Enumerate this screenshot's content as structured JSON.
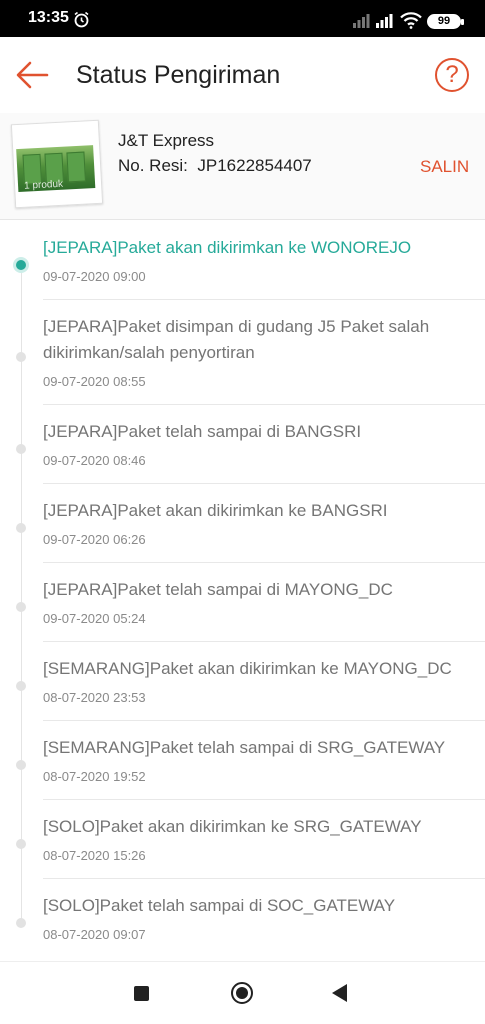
{
  "status_bar": {
    "time": "13:35",
    "battery": "99",
    "icons": [
      "alarm-icon",
      "signal-icon",
      "signal-icon",
      "wifi-icon",
      "battery-icon"
    ]
  },
  "header": {
    "title": "Status Pengiriman",
    "back_icon": "arrow-left-icon",
    "help_label": "?"
  },
  "shipment": {
    "courier": "J&T Express",
    "resi_label": "No. Resi:",
    "resi_number": "JP1622854407",
    "copy_label": "SALIN",
    "product_count": "1 produk"
  },
  "timeline": [
    {
      "text": "[JEPARA]Paket akan dikirimkan ke WONOREJO",
      "time": "09-07-2020 09:00",
      "active": true
    },
    {
      "text": "[JEPARA]Paket disimpan di gudang J5 Paket salah dikirimkan/salah penyortiran",
      "time": "09-07-2020 08:55",
      "active": false
    },
    {
      "text": "[JEPARA]Paket telah sampai di BANGSRI",
      "time": "09-07-2020 08:46",
      "active": false
    },
    {
      "text": "[JEPARA]Paket akan dikirimkan ke BANGSRI",
      "time": "09-07-2020 06:26",
      "active": false
    },
    {
      "text": "[JEPARA]Paket telah sampai di MAYONG_DC",
      "time": "09-07-2020 05:24",
      "active": false
    },
    {
      "text": "[SEMARANG]Paket akan dikirimkan ke MAYONG_DC",
      "time": "08-07-2020 23:53",
      "active": false
    },
    {
      "text": "[SEMARANG]Paket telah sampai di SRG_GATEWAY",
      "time": "08-07-2020 19:52",
      "active": false
    },
    {
      "text": "[SOLO]Paket akan dikirimkan ke SRG_GATEWAY",
      "time": "08-07-2020 15:26",
      "active": false
    },
    {
      "text": "[SOLO]Paket telah sampai di SOC_GATEWAY",
      "time": "08-07-2020 09:07",
      "active": false
    }
  ],
  "colors": {
    "accent": "#e0522f",
    "active": "#26aa99",
    "text_muted": "#757575"
  },
  "nav_bar": {
    "icons": [
      "recent-apps-icon",
      "home-icon",
      "back-icon"
    ]
  }
}
